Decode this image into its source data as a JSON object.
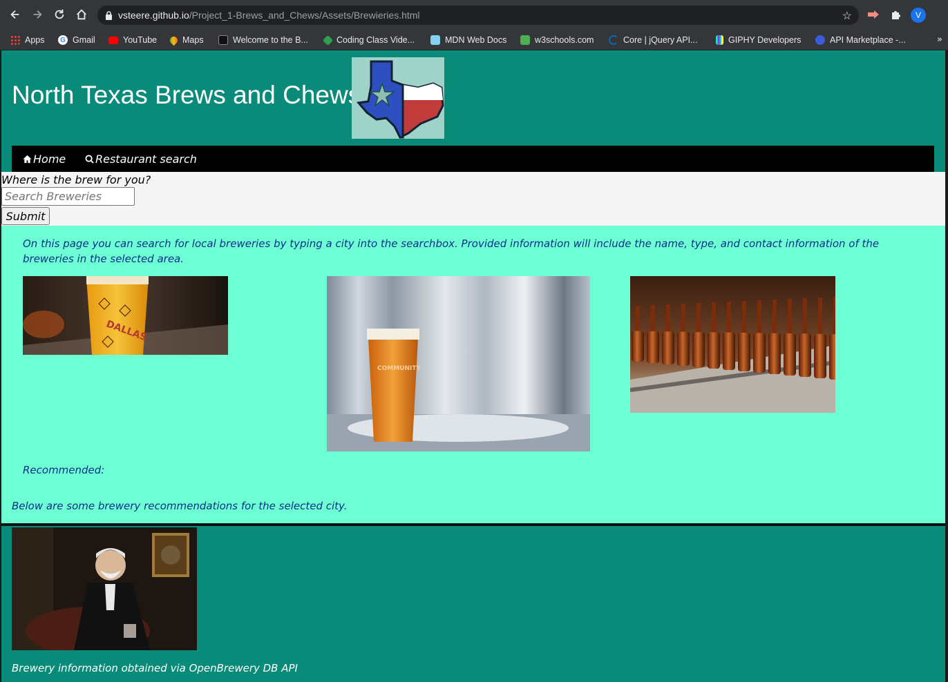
{
  "browser": {
    "url_host": "vsteere.github.io",
    "url_path": "/Project_1-Brews_and_Chews/Assets/Brewieries.html",
    "profile_initial": "V",
    "bookmarks": [
      {
        "label": "Apps",
        "icon": "apps-grid-icon",
        "color": "#4285f4"
      },
      {
        "label": "Gmail",
        "icon": "google-icon",
        "color": "#ffffff"
      },
      {
        "label": "YouTube",
        "icon": "youtube-icon",
        "color": "#ff0000"
      },
      {
        "label": "Maps",
        "icon": "maps-pin-icon",
        "color": "#34a853"
      },
      {
        "label": "Welcome to the B...",
        "icon": "book-icon",
        "color": "#111111"
      },
      {
        "label": "Coding Class Vide...",
        "icon": "cube-icon",
        "color": "#2e9e4f"
      },
      {
        "label": "MDN Web Docs",
        "icon": "mdn-icon",
        "color": "#83d0f2"
      },
      {
        "label": "w3schools.com",
        "icon": "w3schools-icon",
        "color": "#4caf50"
      },
      {
        "label": "Core | jQuery API...",
        "icon": "jquery-icon",
        "color": "#0769ad"
      },
      {
        "label": "GIPHY Developers",
        "icon": "giphy-icon",
        "color": "#fff35c"
      },
      {
        "label": "API Marketplace -...",
        "icon": "api-icon",
        "color": "#3b5bdb"
      }
    ]
  },
  "header": {
    "title": "North Texas Brews and Chews"
  },
  "nav": {
    "home_label": "Home",
    "search_label": "Restaurant search"
  },
  "search": {
    "prompt": "Where is the brew for you?",
    "placeholder": "Search Breweries",
    "submit_label": "Submit"
  },
  "content": {
    "intro": "On this page you can search for local breweries by typing a city into the searchbox. Provided information will include the name, type, and contact information of the breweries in the selected area.",
    "recommended_label": "Recommended:",
    "below_text": "Below are some brewery recommendations for the selected city.",
    "glass_print": "DALLAS",
    "pint_print": "COMMUNITY"
  },
  "footer": {
    "credit": "Brewery information obtained via OpenBrewery DB API"
  },
  "colors": {
    "page_teal": "#0a8b7a",
    "content_mint": "#6dffd3",
    "text_navy": "#0a2e8a",
    "nav_black": "#000000"
  }
}
